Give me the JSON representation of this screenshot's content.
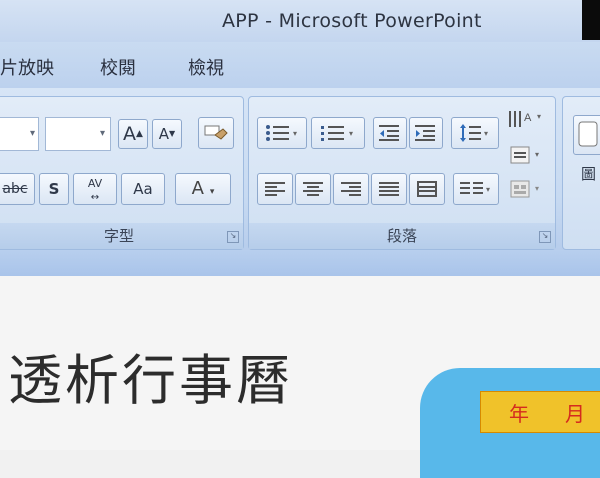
{
  "window": {
    "title": "APP - Microsoft PowerPoint"
  },
  "tabs": [
    {
      "label": "片放映"
    },
    {
      "label": "校閱"
    },
    {
      "label": "檢視"
    }
  ],
  "ribbon": {
    "font_group": {
      "label": "字型",
      "grow_font": "A",
      "shrink_font": "A",
      "strike": "abc",
      "shadow": "S",
      "spacing": "AV",
      "change_case": "Aa",
      "font_color": "A"
    },
    "paragraph_group": {
      "label": "段落"
    },
    "right_group_partial": "圖"
  },
  "slide": {
    "title": "透析行事曆",
    "shape_text_left": "年",
    "shape_text_right": "月"
  },
  "colors": {
    "ribbon_bg": "#c6d9f1",
    "shape_blue": "#58b8ea",
    "shape_yellow": "#f0c22a",
    "shape_text": "#d52b1e"
  }
}
